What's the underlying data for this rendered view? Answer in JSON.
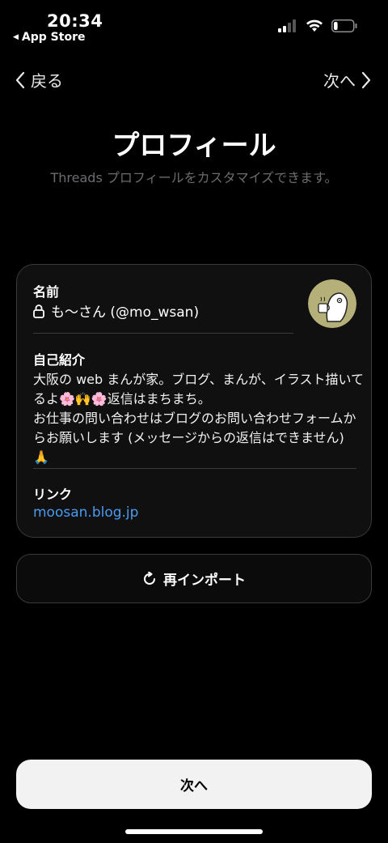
{
  "status": {
    "time": "20:34",
    "back_app": "App Store",
    "battery_level": 0.2
  },
  "nav": {
    "back_label": "戻る",
    "next_label": "次へ"
  },
  "header": {
    "title": "プロフィール",
    "subtitle": "Threads プロフィールをカスタマイズできます。"
  },
  "profile": {
    "name_label": "名前",
    "name_value": "も〜さん (@mo_wsan)",
    "bio_label": "自己紹介",
    "bio_text": "大阪の web まんが家。ブログ、まんが、イラスト描いてるよ🌸🙌🌸返信はまちまち。\nお仕事の問い合わせはブログのお問い合わせフォームからお願いします (メッセージからの返信はできません)\n🙏",
    "link_label": "リンク",
    "link_value": "moosan.blog.jp"
  },
  "actions": {
    "reimport_label": "再インポート",
    "next_label": "次へ"
  },
  "colors": {
    "link": "#4a9bf0",
    "avatar_bg": "#b5b079"
  },
  "icons": [
    "chevron-left-icon",
    "chevron-right-icon",
    "lock-icon",
    "refresh-icon",
    "signal-icon",
    "wifi-icon",
    "battery-icon"
  ]
}
